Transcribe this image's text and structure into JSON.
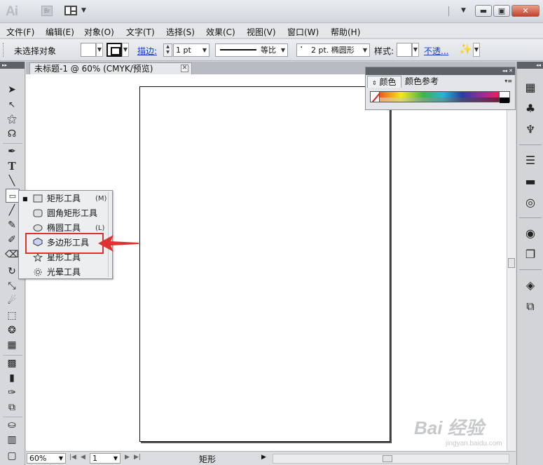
{
  "app": {
    "logo": "Ai",
    "bridge_label": "Br"
  },
  "menu": [
    "文件(F)",
    "编辑(E)",
    "对象(O)",
    "文字(T)",
    "选择(S)",
    "效果(C)",
    "视图(V)",
    "窗口(W)",
    "帮助(H)"
  ],
  "control": {
    "selection": "未选择对象",
    "stroke_label": "描边:",
    "stroke_weight": "1 pt",
    "stroke_profile": "等比",
    "brush": "2 pt. 椭圆形",
    "style_label": "样式:",
    "opacity_label": "不透..."
  },
  "document": {
    "tab_title": "未标题-1 @ 60% (CMYK/预览)"
  },
  "color_panel": {
    "tabs": [
      "颜色",
      "颜色参考"
    ]
  },
  "flyout": {
    "items": [
      {
        "label": "矩形工具",
        "shortcut": "(M)",
        "icon": "rectangle-icon"
      },
      {
        "label": "圆角矩形工具",
        "shortcut": "",
        "icon": "rounded-rectangle-icon"
      },
      {
        "label": "椭圆工具",
        "shortcut": "(L)",
        "icon": "ellipse-icon"
      },
      {
        "label": "多边形工具",
        "shortcut": "",
        "icon": "polygon-icon"
      },
      {
        "label": "星形工具",
        "shortcut": "",
        "icon": "star-icon"
      },
      {
        "label": "光晕工具",
        "shortcut": "",
        "icon": "flare-icon"
      }
    ]
  },
  "status": {
    "zoom": "60%",
    "artboard": "1",
    "current_tool": "矩形"
  },
  "watermark": {
    "text": "Bai 经验",
    "url": "jingyan.baidu.com"
  },
  "colors": {
    "highlight": "#e03030",
    "link": "#1a3ccc"
  }
}
